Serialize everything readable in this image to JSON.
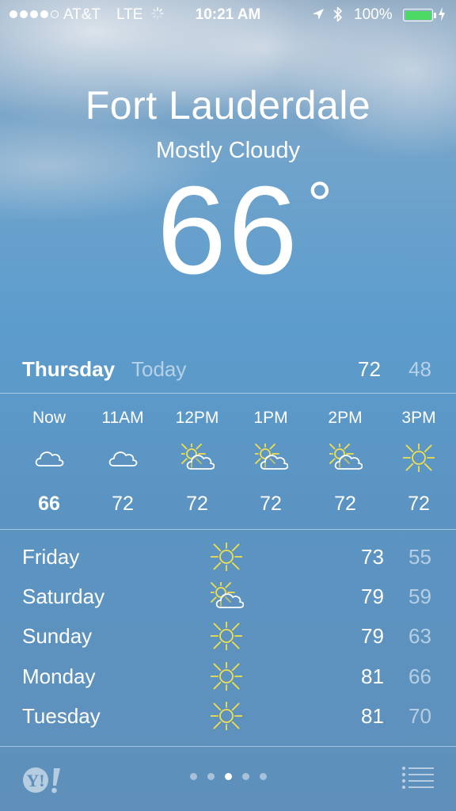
{
  "status_bar": {
    "carrier": "AT&T",
    "network": "LTE",
    "activity_icon": "network-activity-spinner",
    "time": "10:21 AM",
    "battery_percent": "100%",
    "battery_level": 1.0,
    "signal_bars_filled": 4,
    "signal_bars_total": 5,
    "battery_color": "#4cd964"
  },
  "header": {
    "city": "Fort Lauderdale",
    "condition": "Mostly Cloudy",
    "temperature": "66",
    "degree_symbol": "°"
  },
  "today": {
    "day": "Thursday",
    "label": "Today",
    "high": "72",
    "low": "48"
  },
  "hourly": [
    {
      "time": "Now",
      "icon": "cloud-icon",
      "temp": "66"
    },
    {
      "time": "11AM",
      "icon": "cloud-icon",
      "temp": "72"
    },
    {
      "time": "12PM",
      "icon": "partly-sunny-icon",
      "temp": "72"
    },
    {
      "time": "1PM",
      "icon": "partly-sunny-icon",
      "temp": "72"
    },
    {
      "time": "2PM",
      "icon": "partly-sunny-icon",
      "temp": "72"
    },
    {
      "time": "3PM",
      "icon": "sun-icon",
      "temp": "72"
    }
  ],
  "daily": [
    {
      "day": "Friday",
      "icon": "sun-icon",
      "high": "73",
      "low": "55"
    },
    {
      "day": "Saturday",
      "icon": "partly-sunny-icon",
      "high": "79",
      "low": "59"
    },
    {
      "day": "Sunday",
      "icon": "sun-icon",
      "high": "79",
      "low": "63"
    },
    {
      "day": "Monday",
      "icon": "sun-icon",
      "high": "81",
      "low": "66"
    },
    {
      "day": "Tuesday",
      "icon": "sun-icon",
      "high": "81",
      "low": "70"
    }
  ],
  "bottom_bar": {
    "logo": "Y!",
    "logo_icon": "yahoo-logo",
    "page_count": 5,
    "active_page": 3,
    "list_icon": "list-icon"
  },
  "colors": {
    "sun": "#f2e04a",
    "sky": "#5c9ccd",
    "text": "#ffffff",
    "muted": "rgba(255,255,255,0.55)"
  }
}
